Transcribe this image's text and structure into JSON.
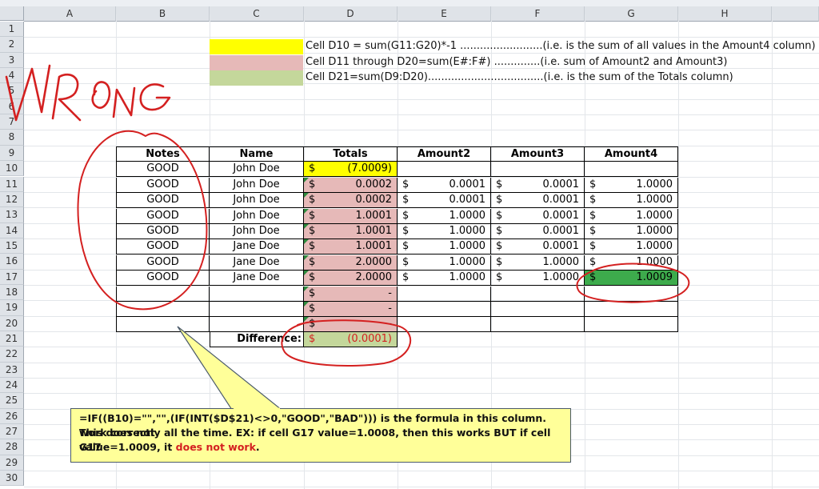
{
  "columns": [
    "A",
    "B",
    "C",
    "D",
    "E",
    "F",
    "G",
    "H"
  ],
  "rows": [
    "1",
    "2",
    "3",
    "4",
    "5",
    "6",
    "7",
    "8",
    "9",
    "10",
    "11",
    "12",
    "13",
    "14",
    "15",
    "16",
    "17",
    "18",
    "19",
    "20",
    "21",
    "22",
    "23",
    "24",
    "25",
    "26",
    "27",
    "28",
    "29",
    "30"
  ],
  "colors": {
    "yellow": "#ffff00",
    "pink": "#e6b9b8",
    "green_light": "#c4d79b",
    "green_strong": "#3dab4c",
    "red_ink": "#d42020",
    "callout": "#ffff99"
  },
  "legend": [
    {
      "color": "yellow",
      "text": "Cell D10 = sum(G11:G20)*-1  .........................(i.e. is the sum of all values in the Amount4 column)"
    },
    {
      "color": "pink",
      "text": "Cell D11 through D20=sum(E#:F#) ..............(i.e. sum of Amount2 and Amount3)"
    },
    {
      "color": "green_light",
      "text": "Cell D21=sum(D9:D20)...................................(i.e. is the sum of the Totals column)"
    }
  ],
  "table": {
    "headers": [
      "Notes",
      "Name",
      "Totals",
      "Amount2",
      "Amount3",
      "Amount4"
    ],
    "rows": [
      {
        "notes": "GOOD",
        "name": "John Doe",
        "total": "(7.0009)",
        "a2": "",
        "a3": "",
        "a4": ""
      },
      {
        "notes": "GOOD",
        "name": "John Doe",
        "total": "0.0002",
        "a2": "0.0001",
        "a3": "0.0001",
        "a4": "1.0000"
      },
      {
        "notes": "GOOD",
        "name": "John Doe",
        "total": "0.0002",
        "a2": "0.0001",
        "a3": "0.0001",
        "a4": "1.0000"
      },
      {
        "notes": "GOOD",
        "name": "John Doe",
        "total": "1.0001",
        "a2": "1.0000",
        "a3": "0.0001",
        "a4": "1.0000"
      },
      {
        "notes": "GOOD",
        "name": "John Doe",
        "total": "1.0001",
        "a2": "1.0000",
        "a3": "0.0001",
        "a4": "1.0000"
      },
      {
        "notes": "GOOD",
        "name": "Jane Doe",
        "total": "1.0001",
        "a2": "1.0000",
        "a3": "0.0001",
        "a4": "1.0000"
      },
      {
        "notes": "GOOD",
        "name": "Jane Doe",
        "total": "2.0000",
        "a2": "1.0000",
        "a3": "1.0000",
        "a4": "1.0000"
      },
      {
        "notes": "GOOD",
        "name": "Jane Doe",
        "total": "2.0000",
        "a2": "1.0000",
        "a3": "1.0000",
        "a4": "1.0009"
      },
      {
        "notes": "",
        "name": "",
        "total": "-",
        "a2": "",
        "a3": "",
        "a4": ""
      },
      {
        "notes": "",
        "name": "",
        "total": "-",
        "a2": "",
        "a3": "",
        "a4": ""
      },
      {
        "notes": "",
        "name": "",
        "total": "-",
        "a2": "",
        "a3": "",
        "a4": ""
      }
    ],
    "currency": "$",
    "difference_label": "Difference:",
    "difference_value": "(0.0001)"
  },
  "annotation": {
    "wrong": "WRONG"
  },
  "callout": {
    "line1": "=IF((B10)=\"\",\"\",(IF(INT($D$21)<>0,\"GOOD\",\"BAD\"))) is the formula in this column. This does not",
    "line2": "work correctly all the time.  EX: if cell G17 value=1.0008, then this works BUT if cell G17",
    "line3_a": "value=1.0009, it ",
    "line3_b": "does not work",
    "line3_c": "."
  }
}
